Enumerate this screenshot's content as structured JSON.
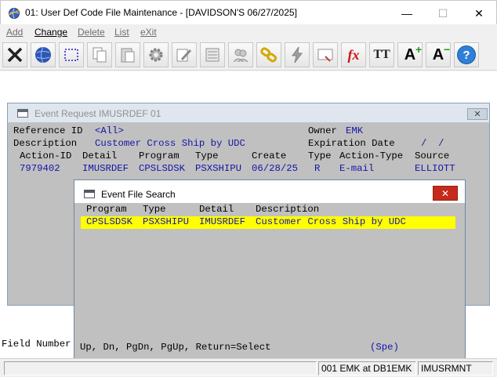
{
  "window": {
    "title": "01: User Def Code File Maintenance - [DAVIDSON'S 06/27/2025]",
    "minimize": "—",
    "maximize": "☐",
    "close": "✕"
  },
  "menu": [
    {
      "label": "Add",
      "enabled": false
    },
    {
      "label": "Change",
      "enabled": true
    },
    {
      "label": "Delete",
      "enabled": false
    },
    {
      "label": "List",
      "enabled": false
    },
    {
      "label": "eXit",
      "enabled": false
    }
  ],
  "toolbar": {
    "buttons": [
      "close-x-icon",
      "globe-icon",
      "select-rect-icon",
      "copy-icon",
      "paste-icon",
      "settings-gear-icon",
      "edit-pencil-icon",
      "list-icon",
      "users-icon",
      "link-chain-icon",
      "lightning-icon",
      "screen-arrow-icon",
      "fx-function-icon",
      "font-tt-icon",
      "font-increase-icon",
      "font-decrease-icon",
      "help-icon"
    ],
    "fx_label": "fx",
    "tt_label": "TT",
    "font_plus_label": "A",
    "font_minus_label": "A",
    "help_label": "?"
  },
  "event_request": {
    "title": "Event Request IMUSRDEF 01",
    "close": "✕",
    "ref_label": "Reference ID",
    "ref_value": "<All>",
    "owner_label": "Owner",
    "owner_value": "EMK",
    "desc_label": "Description",
    "desc_value": "Customer Cross Ship by UDC",
    "exp_label": "Expiration Date",
    "exp_value": "/  /",
    "columns": [
      "Action-ID",
      "Detail",
      "Program",
      "Type",
      "Create",
      "Type",
      "Action-Type",
      "Source"
    ],
    "row": {
      "action_id": "7979402",
      "detail": "IMUSRDEF",
      "program": "CPSLSDSK",
      "type": "PSXSHIPU",
      "create": "06/28/25",
      "type2": "R",
      "action_type": "E-mail",
      "source": "ELLIOTT"
    }
  },
  "field_number_label": "Field Number",
  "event_file_search": {
    "title": "Event File Search",
    "close": "✕",
    "columns": [
      "Program",
      "Type",
      "Detail",
      "Description"
    ],
    "rows": [
      {
        "program": "CPSLSDSK",
        "type": "PSXSHIPU",
        "detail": "IMUSRDEF",
        "description": "Customer Cross Ship by UDC"
      }
    ],
    "footer_keys": "Up, Dn, PgDn, PgUp, Return=Select",
    "footer_spe": "(Spe)"
  },
  "status": {
    "cell1": "",
    "cell2": "001 EMK at DB1EMK",
    "cell3": "IMUSRMNT"
  },
  "colors": {
    "highlight": "#ffff00",
    "field_blue": "#1515a8",
    "close_red": "#c42b1c"
  }
}
